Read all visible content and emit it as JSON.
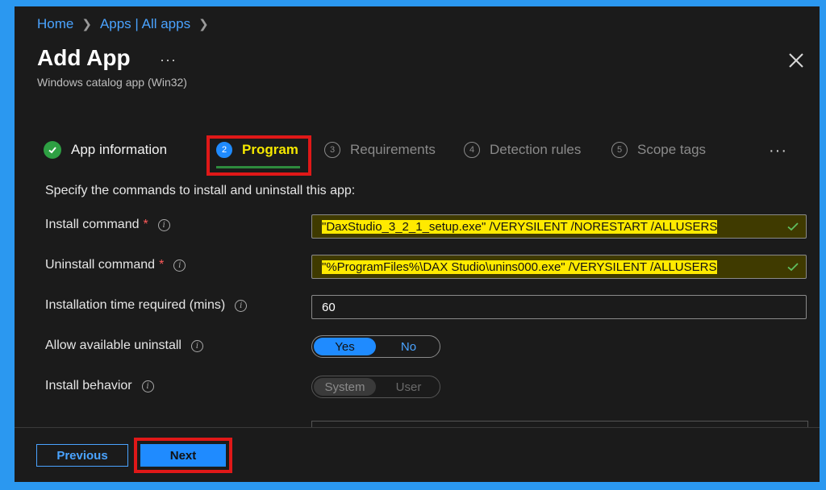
{
  "breadcrumb": {
    "home": "Home",
    "apps": "Apps | All apps"
  },
  "header": {
    "title": "Add App",
    "subtitle": "Windows catalog app (Win32)",
    "more": "···"
  },
  "tabs": [
    {
      "label": "App information",
      "num": "",
      "state": "done"
    },
    {
      "label": "Program",
      "num": "2",
      "state": "active"
    },
    {
      "label": "Requirements",
      "num": "3",
      "state": "pending"
    },
    {
      "label": "Detection rules",
      "num": "4",
      "state": "pending"
    },
    {
      "label": "Scope tags",
      "num": "5",
      "state": "pending"
    }
  ],
  "tabs_more": "···",
  "form": {
    "intro": "Specify the commands to install and uninstall this app:",
    "install_label": "Install command",
    "install_value": "\"DaxStudio_3_2_1_setup.exe\" /VERYSILENT /NORESTART /ALLUSERS",
    "uninstall_label": "Uninstall command",
    "uninstall_value": "\"%ProgramFiles%\\DAX Studio\\unins000.exe\" /VERYSILENT /ALLUSERS",
    "time_label": "Installation time required (mins)",
    "time_value": "60",
    "allow_label": "Allow available uninstall",
    "allow_yes": "Yes",
    "allow_no": "No",
    "behavior_label": "Install behavior",
    "behavior_system": "System",
    "behavior_user": "User",
    "required_mark": "*",
    "info": "i"
  },
  "footer": {
    "previous": "Previous",
    "next": "Next"
  },
  "colors": {
    "accent": "#1f8bff",
    "highlight": "#ffea00",
    "annotation": "#e01818",
    "success": "#2ea043"
  }
}
